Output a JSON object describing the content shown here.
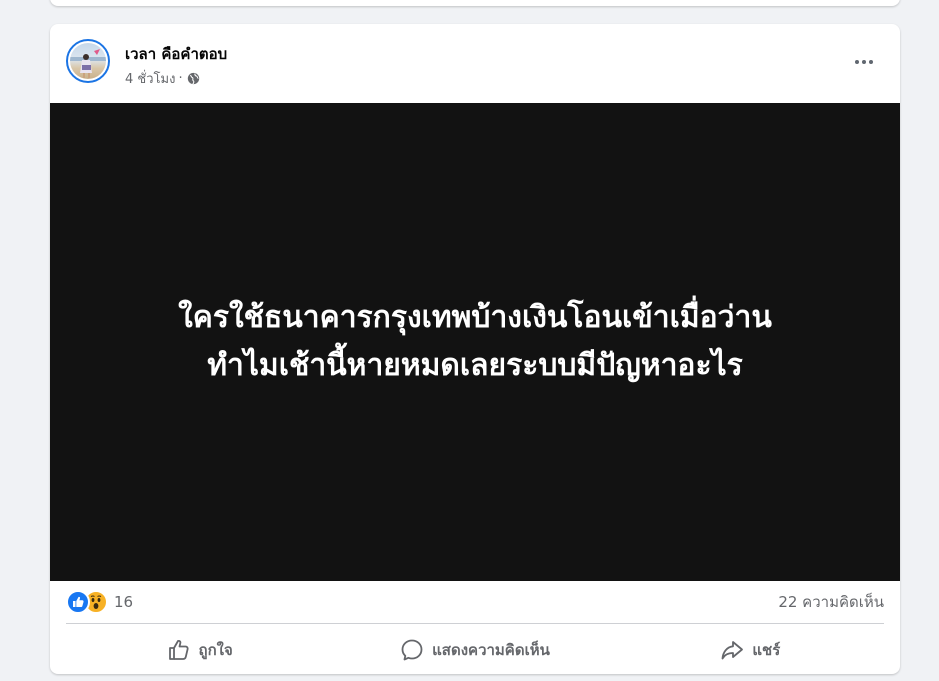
{
  "post": {
    "author": "เวลา คือคำตอบ",
    "time": "4 ชั่วโมง",
    "separator": "·",
    "visibility_icon": "globe-icon",
    "more_icon": "more-options-icon",
    "media": {
      "background_color": "#121212",
      "text_color": "#ffffff",
      "lines": [
        "ใครใช้ธนาคารกรุงเทพบ้างเงินโอนเข้าเมื่อว่าน",
        "ทำไมเช้านี้หายหมดเลยระบบมีปัญหาอะไร"
      ]
    },
    "stats": {
      "reaction_icons": [
        "like-reaction-icon",
        "wow-reaction-icon"
      ],
      "reaction_count": "16",
      "comment_count": "22 ความคิดเห็น"
    },
    "actions": {
      "like_label": "ถูกใจ",
      "comment_label": "แสดงความคิดเห็น",
      "share_label": "แชร์"
    }
  },
  "colors": {
    "page_background": "#f0f2f5",
    "accent": "#1877f2",
    "secondary_text": "#65676b"
  }
}
